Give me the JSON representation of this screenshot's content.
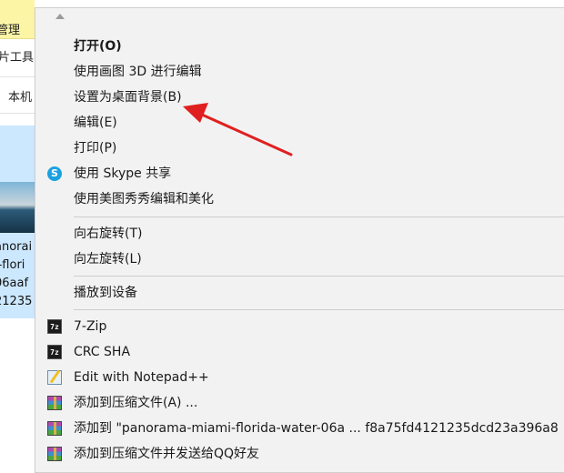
{
  "explorer": {
    "ribbon_tab": "管理",
    "tools_label": "片工具",
    "pc_label": "本机",
    "filename_lines": [
      "anorai",
      "i-flori",
      "06aaf",
      "21235"
    ]
  },
  "menu": {
    "items": [
      {
        "label": "打开(O)",
        "icon": ""
      },
      {
        "label": "使用画图 3D 进行编辑",
        "icon": ""
      },
      {
        "label": "设置为桌面背景(B)",
        "icon": ""
      },
      {
        "label": "编辑(E)",
        "icon": ""
      },
      {
        "label": "打印(P)",
        "icon": ""
      },
      {
        "label": "使用 Skype 共享",
        "icon": "skype-icon"
      },
      {
        "label": "使用美图秀秀编辑和美化",
        "icon": ""
      },
      {
        "label": "向右旋转(T)",
        "icon": ""
      },
      {
        "label": "向左旋转(L)",
        "icon": ""
      },
      {
        "label": "播放到设备",
        "icon": ""
      },
      {
        "label": "7-Zip",
        "icon": "7zip-icon"
      },
      {
        "label": "CRC SHA",
        "icon": "7zip-icon"
      },
      {
        "label": "Edit with Notepad++",
        "icon": "notepad-plus-icon"
      },
      {
        "label": "添加到压缩文件(A) ...",
        "icon": "winrar-icon"
      },
      {
        "label": "添加到 \"panorama-miami-florida-water-06a ... f8a75fd4121235dcd23a396a8",
        "icon": "winrar-icon"
      },
      {
        "label": "添加到压缩文件并发送给QQ好友",
        "icon": "winrar-icon"
      }
    ]
  },
  "icon_glyphs": {
    "skype": "S",
    "zip": "7z"
  },
  "colors": {
    "menu_bg": "#f2f2f2",
    "arrow": "#e02020",
    "selection": "#cce8ff",
    "ribbon_tab": "#fdf5a6"
  }
}
